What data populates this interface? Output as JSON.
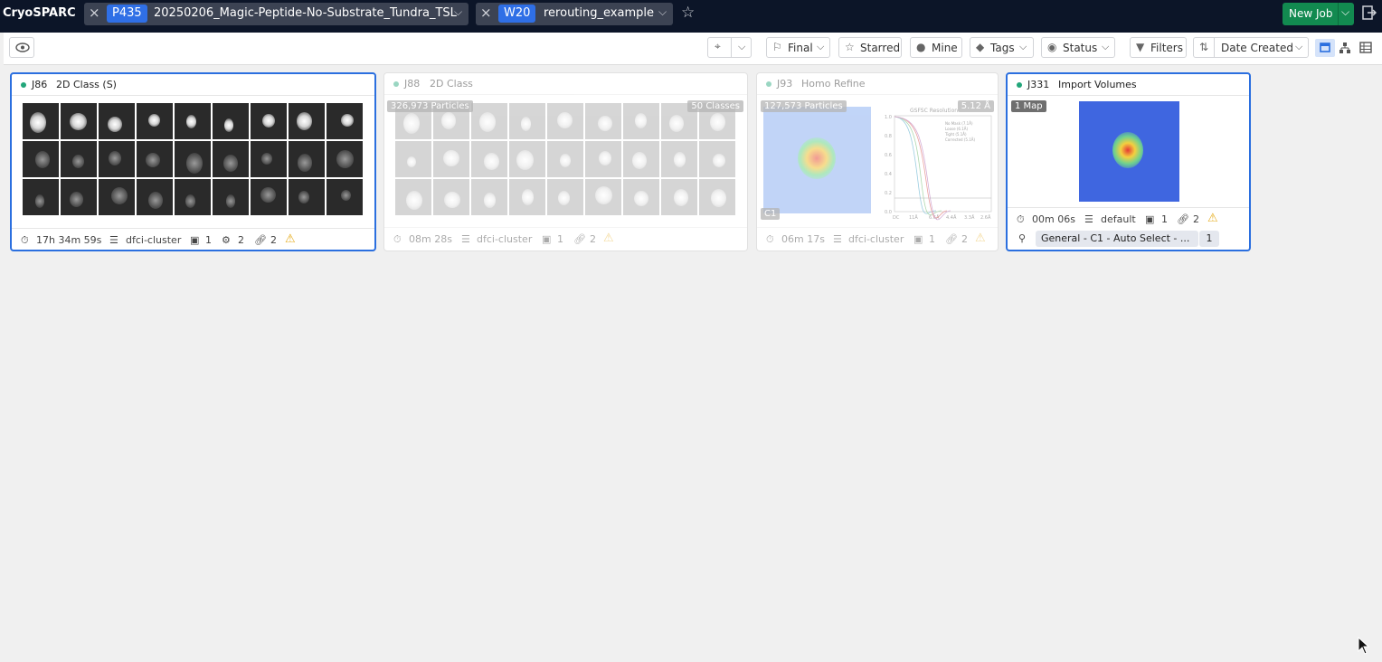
{
  "app": {
    "title": "CryoSPARC"
  },
  "tabs": [
    {
      "badge": "P435",
      "label": "20250206_Magic-Peptide-No-Substrate_Tundra_TSL"
    },
    {
      "badge": "W20",
      "label": "rerouting_example"
    }
  ],
  "new_job_label": "New Job",
  "toolbar": {
    "final": "Final",
    "starred": "Starred",
    "mine": "Mine",
    "tags": "Tags",
    "status": "Status",
    "filters": "Filters",
    "sort": "Date Created"
  },
  "cards": [
    {
      "id": "J86",
      "title": "2D Class (S)",
      "time": "17h 34m 59s",
      "lane": "dfci-cluster",
      "params": "1",
      "outputs": "2",
      "links": "2"
    },
    {
      "id": "J88",
      "title": "2D Class",
      "particles": "326,973 Particles",
      "classes": "50 Classes",
      "time": "08m 28s",
      "lane": "dfci-cluster",
      "params": "1",
      "links": "2"
    },
    {
      "id": "J93",
      "title": "Homo Refine",
      "particles": "127,573 Particles",
      "resolution": "5.12 Å",
      "symmetry": "C1",
      "fsc_title": "GSFSC Resolution",
      "fsc_legend": [
        "No Mask (7.1Å)",
        "Loose (6.1Å)",
        "Tight (5.1Å)",
        "Corrected (5.1Å)"
      ],
      "fsc_yticks": [
        "1.0",
        "0.8",
        "0.6",
        "0.4",
        "0.2",
        "0.0"
      ],
      "fsc_xticks": [
        "DC",
        "11Å",
        "6.6Å",
        "4.4Å",
        "3.3Å",
        "2.6Å"
      ],
      "time": "06m 17s",
      "lane": "dfci-cluster",
      "params": "1",
      "links": "2"
    },
    {
      "id": "J331",
      "title": "Import Volumes",
      "maps": "1 Map",
      "time": "00m 06s",
      "lane": "default",
      "params": "1",
      "links": "2",
      "workflow": "General - C1 - Auto Select - ...",
      "workflow_count": "1"
    }
  ],
  "colors": {
    "topbar": "#0c1528",
    "accent": "#2b6fdf",
    "new_job": "#128a50",
    "status_dot": "#22a67a",
    "warning": "#e6ad1f"
  }
}
